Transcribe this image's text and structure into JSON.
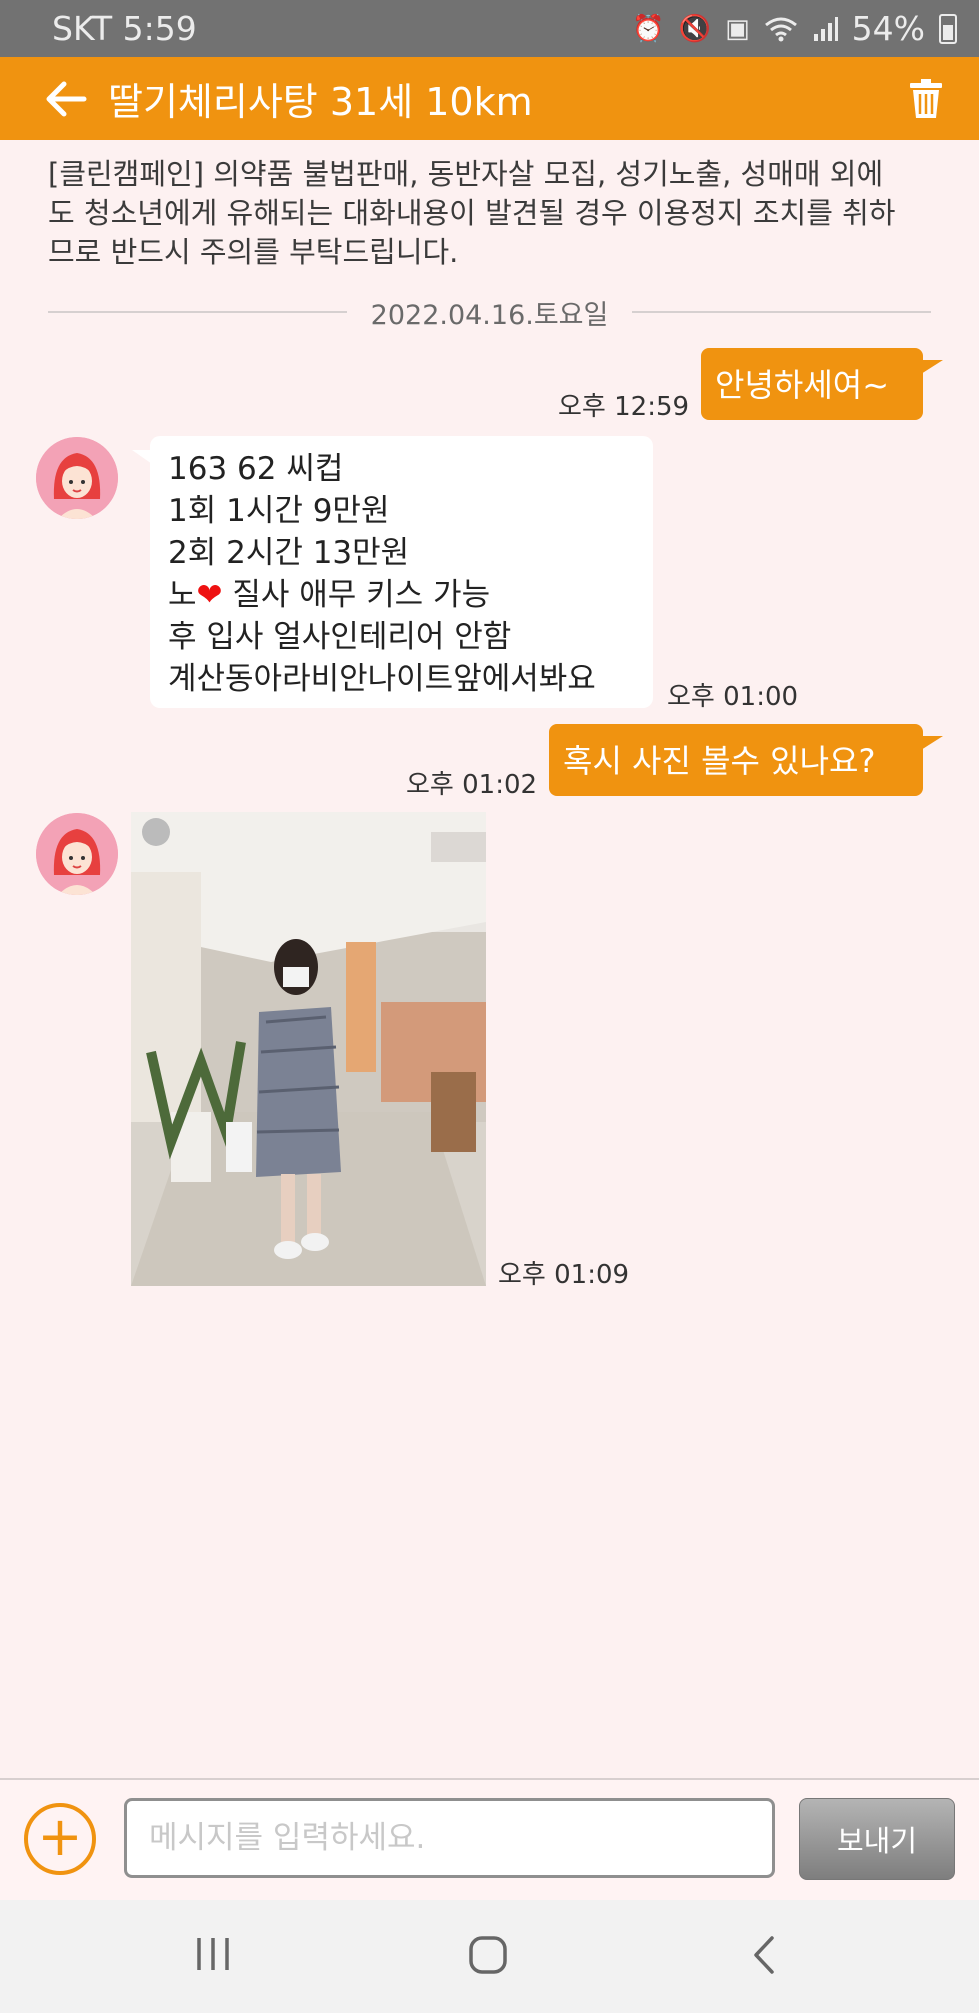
{
  "status_bar": {
    "carrier_time": "SKT 5:59",
    "battery_percent": "54%",
    "icons": [
      "alarm-icon",
      "mute-icon",
      "notification-icon",
      "wifi-icon",
      "signal-icon",
      "battery-icon"
    ]
  },
  "header": {
    "title": "딸기체리사탕 31세 10km",
    "back_icon": "back-arrow-icon",
    "delete_icon": "trash-icon"
  },
  "notice": "[클린캠페인] 의약품 불법판매, 동반자살 모집, 성기노출, 성매매 외에도 청소년에게 유해되는 대화내용이 발견될 경우 이용정지 조치를 취하므로 반드시 주의를 부탁드립니다.",
  "date_separator": "2022.04.16.토요일",
  "messages": [
    {
      "direction": "outgoing",
      "text": "안녕하세여~",
      "time": "오후 12:59"
    },
    {
      "direction": "incoming",
      "lines": [
        "163 62  씨컵",
        "1회 1시간 9만원",
        "2회 2시간 13만원",
        "노",
        "질사 애무 키스 가능",
        "후 입사 얼사인테리어 안함",
        "계산동아라비안나이트앞에서봐요"
      ],
      "emoji": "heart-icon",
      "time": "오후 01:00"
    },
    {
      "direction": "outgoing",
      "text": "혹시 사진 볼수 있나요?",
      "time": "오후 01:02"
    },
    {
      "direction": "incoming",
      "type": "photo",
      "time": "오후 01:09"
    }
  ],
  "input": {
    "placeholder": "메시지를 입력하세요.",
    "send_label": "보내기",
    "attach_icon": "plus-icon"
  },
  "nav": [
    "recent-apps-icon",
    "home-icon",
    "back-icon"
  ],
  "colors": {
    "accent": "#f09310",
    "background": "#fdf1f1",
    "status_bar": "#727272"
  }
}
